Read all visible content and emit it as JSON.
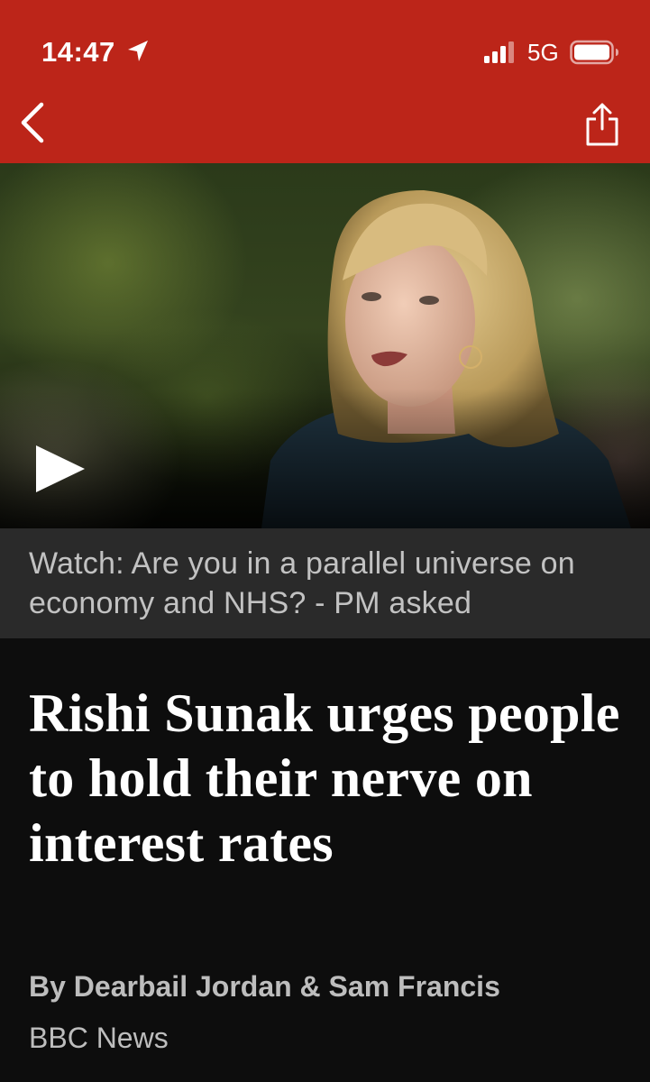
{
  "status_bar": {
    "time": "14:47",
    "network": "5G",
    "location_icon": "location-arrow-icon",
    "signal_icon": "cellular-signal-icon",
    "battery_icon": "battery-icon"
  },
  "app_bar": {
    "back_icon": "chevron-left-icon",
    "share_icon": "share-icon",
    "background_color": "#bc2519"
  },
  "video": {
    "play_icon": "play-icon",
    "caption": "Watch: Are you in a parallel universe on economy and NHS? - PM asked"
  },
  "article": {
    "headline": "Rishi Sunak urges people to hold their nerve on interest rates",
    "byline": "By Dearbail Jordan & Sam Francis",
    "source": "BBC News"
  }
}
